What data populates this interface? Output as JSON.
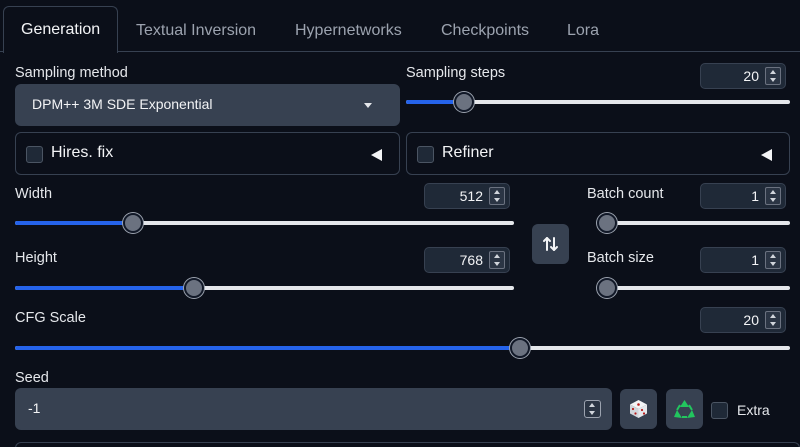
{
  "tabs": [
    "Generation",
    "Textual Inversion",
    "Hypernetworks",
    "Checkpoints",
    "Lora"
  ],
  "active_tab": "Generation",
  "sampling_method": {
    "label": "Sampling method",
    "value": "DPM++ 3M SDE Exponential"
  },
  "sampling_steps": {
    "label": "Sampling steps",
    "value": "20",
    "fraction": 0.15
  },
  "hires_fix": {
    "label": "Hires. fix",
    "checked": false
  },
  "refiner": {
    "label": "Refiner",
    "checked": false
  },
  "width": {
    "label": "Width",
    "value": "512",
    "fraction": 0.236
  },
  "height": {
    "label": "Height",
    "value": "768",
    "fraction": 0.358
  },
  "batch_count": {
    "label": "Batch count",
    "value": "1",
    "fraction": 0.0
  },
  "batch_size": {
    "label": "Batch size",
    "value": "1",
    "fraction": 0.0
  },
  "swap_button": {
    "icon": "swap-arrows-icon"
  },
  "cfg_scale": {
    "label": "CFG Scale",
    "value": "20",
    "fraction": 0.652
  },
  "seed": {
    "label": "Seed",
    "value": "-1",
    "random_icon": "dice-icon",
    "reuse_icon": "recycle-icon",
    "extra_label": "Extra"
  },
  "colors": {
    "accent": "#2563eb",
    "background": "#0b0f19",
    "input": "#374151"
  }
}
